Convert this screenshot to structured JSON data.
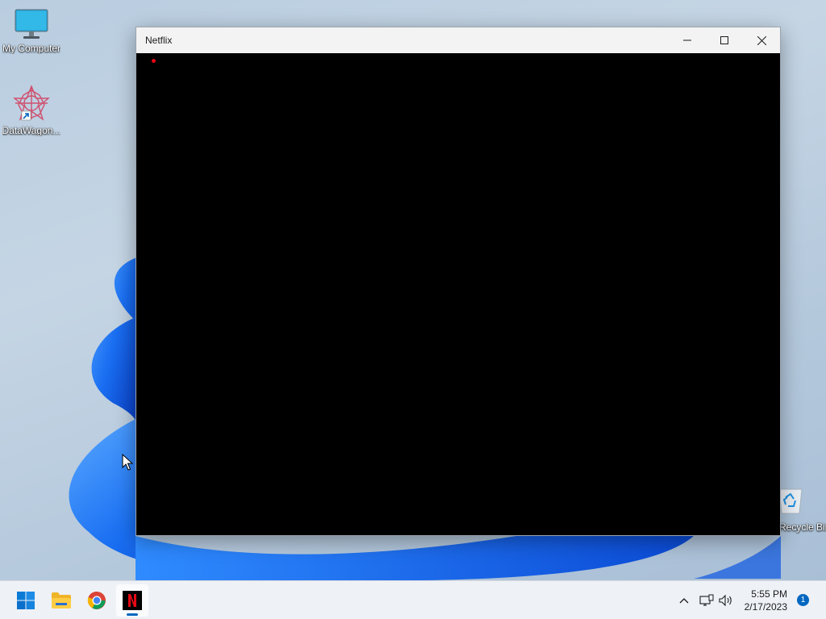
{
  "desktop": {
    "icons": [
      {
        "label": "My Computer",
        "icon": "monitor-icon"
      },
      {
        "label": "DataWagon...",
        "icon": "datawagon-app-icon"
      },
      {
        "label": "Recycle Bin",
        "icon": "recycle-bin-icon"
      }
    ]
  },
  "window": {
    "title": "Netflix",
    "app_icon": "netflix-icon",
    "controls": [
      "minimize-icon",
      "maximize-icon",
      "close-icon"
    ],
    "content_background": "#000000",
    "loading_indicator_color": "#e50914"
  },
  "taskbar": {
    "apps": [
      {
        "name": "Start",
        "icon": "windows-logo-icon"
      },
      {
        "name": "File Explorer",
        "icon": "folder-icon"
      },
      {
        "name": "Google Chrome",
        "icon": "chrome-icon"
      },
      {
        "name": "Netflix",
        "icon": "netflix-icon",
        "active": true
      }
    ],
    "tray": {
      "icons": [
        "chevron-up-icon",
        "network-icon",
        "volume-icon"
      ],
      "time": "5:55 PM",
      "date": "2/17/2023",
      "notification_count": "1"
    }
  },
  "colors": {
    "accent": "#0067c0",
    "netflix_red": "#e50914"
  }
}
